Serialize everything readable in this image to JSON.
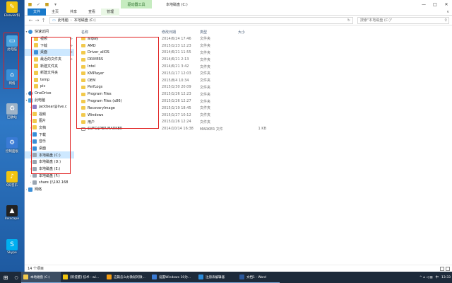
{
  "desktop": {
    "icons": [
      {
        "label": "Elsevier科",
        "color": "#f1c40f",
        "glyph": "✎"
      },
      {
        "label": "此电脑",
        "color": "#4aa3df",
        "glyph": "▭"
      },
      {
        "label": "网络",
        "color": "#3a8fd8",
        "glyph": "⌂"
      },
      {
        "label": "回收站",
        "color": "#9fb4c8",
        "glyph": "♻"
      },
      {
        "label": "控制面板",
        "color": "#3a7bd5",
        "glyph": "⚙"
      },
      {
        "label": "QQ音乐",
        "color": "#f1c40f",
        "glyph": "♪"
      },
      {
        "label": "Inkscape",
        "color": "#222222",
        "glyph": "▲"
      },
      {
        "label": "Skype",
        "color": "#00aff0",
        "glyph": "S"
      }
    ]
  },
  "window": {
    "context_tab": "驱动器工具",
    "title": "本地磁盘 (C:)",
    "controls": [
      "—",
      "□",
      "✕"
    ],
    "ribbon_tabs": [
      "文件",
      "主页",
      "共享",
      "查看",
      "管理"
    ],
    "ribbon_expand": "∨"
  },
  "address": {
    "back": "←",
    "forward": "→",
    "up": "↑",
    "path": [
      "此电脑",
      "本地磁盘 (C:)"
    ],
    "refresh": "↻",
    "search_placeholder": "搜索\"本地磁盘 (C:)\"",
    "search_icon": "⚲"
  },
  "nav": {
    "quick_access": "快速访问",
    "quick_items": [
      {
        "label": "视频",
        "pinned": true
      },
      {
        "label": "下载",
        "pinned": true
      },
      {
        "label": "桌面",
        "pinned": true,
        "selected": true
      },
      {
        "label": "最近的文件夹",
        "pinned": true
      },
      {
        "label": "新建文件夹",
        "pinned": false
      },
      {
        "label": "新建文件夹",
        "pinned": false
      },
      {
        "label": "temp",
        "pinned": false
      },
      {
        "label": "pic",
        "pinned": false
      }
    ],
    "onedrive": "OneDrive",
    "this_pc": "此电脑",
    "pc_items": [
      "jackbear@live.c",
      "视频",
      "图片",
      "文档",
      "下载",
      "音乐",
      "桌面"
    ],
    "drives": [
      "本地磁盘 (C:)",
      "本地磁盘 (D:)",
      "本地磁盘 (E:)",
      "本地磁盘 (F:)",
      "share (\\\\192.168"
    ],
    "network": "网络"
  },
  "list": {
    "headers": {
      "name": "名称",
      "date": "修改日期",
      "type": "类型",
      "size": "大小"
    },
    "rows": [
      {
        "name": "alipay",
        "date": "2014/6/24 17:46",
        "type": "文件夹",
        "kind": "folder"
      },
      {
        "name": "AMD",
        "date": "2015/1/23 12:23",
        "type": "文件夹",
        "kind": "folder"
      },
      {
        "name": "Driver_allOS",
        "date": "2014/6/21 11:55",
        "type": "文件夹",
        "kind": "folder"
      },
      {
        "name": "DRIVERS",
        "date": "2014/6/21 2:13",
        "type": "文件夹",
        "kind": "folder"
      },
      {
        "name": "Intel",
        "date": "2014/6/21 3:42",
        "type": "文件夹",
        "kind": "folder"
      },
      {
        "name": "KMPlayer",
        "date": "2015/1/17 12:03",
        "type": "文件夹",
        "kind": "folder"
      },
      {
        "name": "OEM",
        "date": "2015/8/4 10:34",
        "type": "文件夹",
        "kind": "folder"
      },
      {
        "name": "PerfLogs",
        "date": "2015/1/30 20:09",
        "type": "文件夹",
        "kind": "folder"
      },
      {
        "name": "Program Files",
        "date": "2015/1/26 12:23",
        "type": "文件夹",
        "kind": "folder"
      },
      {
        "name": "Program Files (x86)",
        "date": "2015/1/26 12:27",
        "type": "文件夹",
        "kind": "folder"
      },
      {
        "name": "RecoveryImage",
        "date": "2015/1/19 18:45",
        "type": "文件夹",
        "kind": "folder"
      },
      {
        "name": "Windows",
        "date": "2015/1/27 10:12",
        "type": "文件夹",
        "kind": "folder"
      },
      {
        "name": "用户",
        "date": "2015/1/26 12:24",
        "type": "文件夹",
        "kind": "folder"
      },
      {
        "name": "$UFG$PBR.MARKER",
        "date": "2014/10/14 16:38",
        "type": "MARKER 文件",
        "size": "1 KB",
        "kind": "file"
      }
    ]
  },
  "status": {
    "count": "14 个项目"
  },
  "taskbar": {
    "start": "⊞",
    "search": "○",
    "tasks": [
      {
        "label": "本地磁盘 (C:)",
        "color": "#f2c94c",
        "active": true
      },
      {
        "label": "[新提醒] 技术 - wi...",
        "color": "#f1c40f",
        "active": false
      },
      {
        "label": "这篇怎么办微就的微...",
        "color": "#f39c12",
        "active": false
      },
      {
        "label": "设置Windows 10为...",
        "color": "#3a7bd5",
        "active": false
      },
      {
        "label": "注册表编辑器",
        "color": "#2b8ad8",
        "active": false
      },
      {
        "label": "文档1 - Word",
        "color": "#2b579a",
        "active": false
      }
    ],
    "tray_symbols": "^ ⌂ ◁ ▤",
    "tray_lang": "中",
    "clock": "13:33"
  }
}
